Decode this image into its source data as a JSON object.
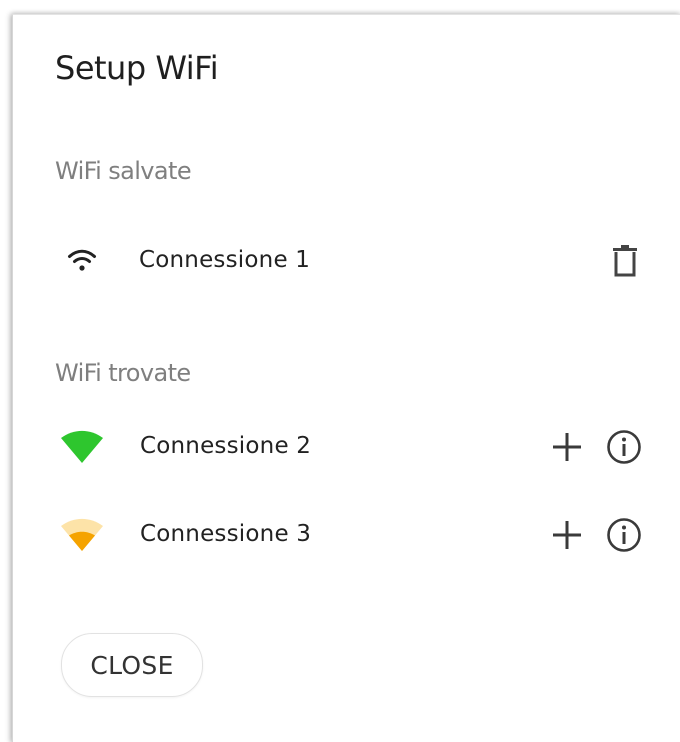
{
  "dialog": {
    "title": "Setup WiFi",
    "close_label": "CLOSE"
  },
  "saved": {
    "heading": "WiFi salvate",
    "items": [
      {
        "ssid": "Connessione 1",
        "icon": "wifi-icon",
        "action_icon": "trash-icon"
      }
    ]
  },
  "found": {
    "heading": "WiFi trovate",
    "items": [
      {
        "ssid": "Connessione 2",
        "icon": "wifi-signal-strong-icon",
        "color": "#2ec62e",
        "actions": [
          "add-icon",
          "info-icon"
        ]
      },
      {
        "ssid": "Connessione 3",
        "icon": "wifi-signal-weak-icon",
        "color": "#f5a300",
        "actions": [
          "add-icon",
          "info-icon"
        ]
      }
    ]
  },
  "colors": {
    "signal_strong": "#2ec62e",
    "signal_weak": "#f5a300",
    "signal_weak_faded": "#fde3a8",
    "icon_dark": "#2a2a2a"
  }
}
